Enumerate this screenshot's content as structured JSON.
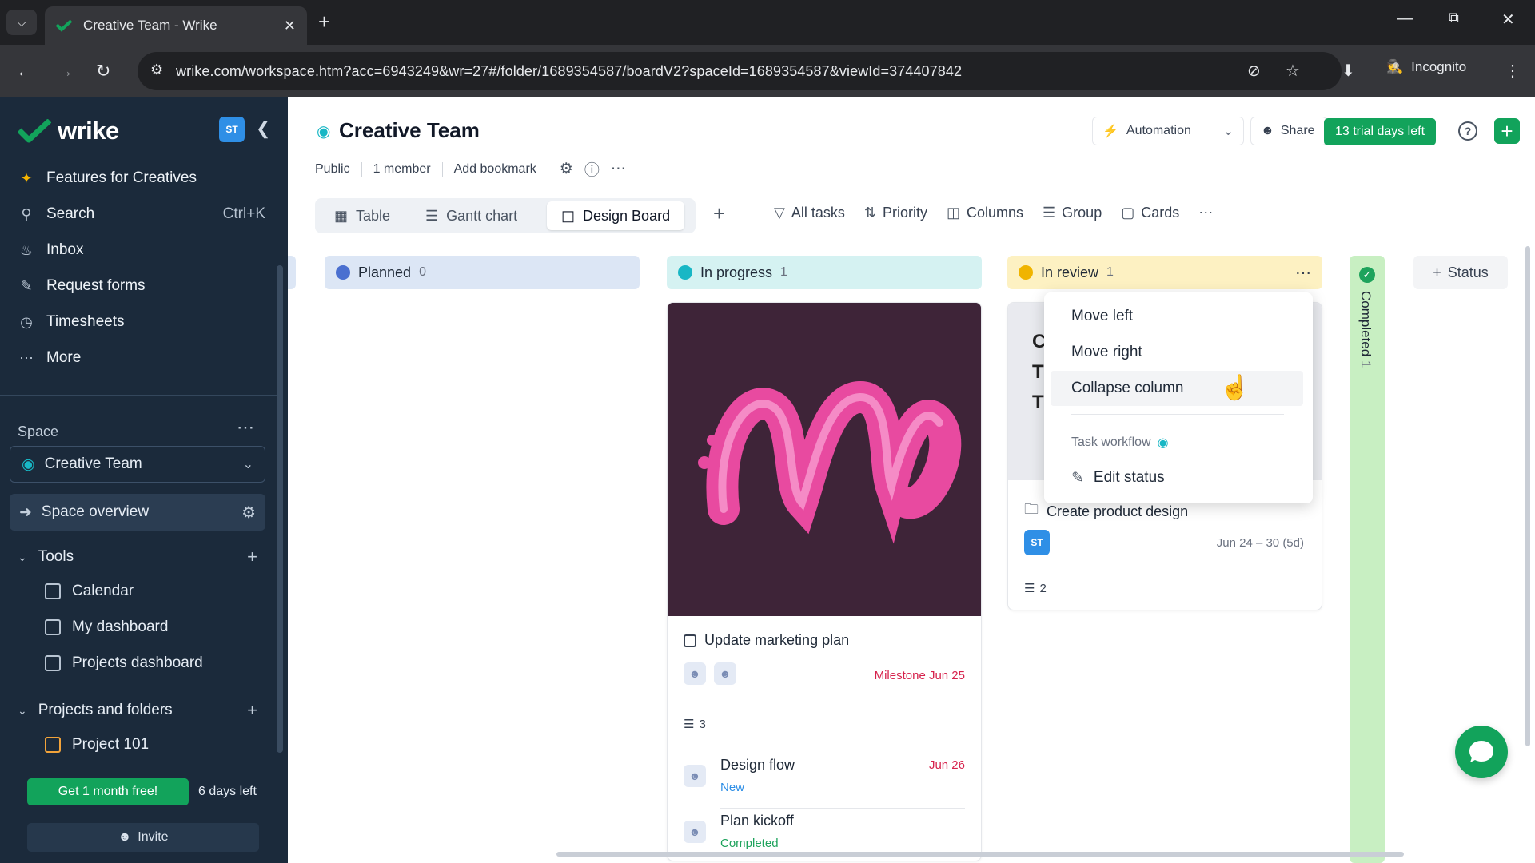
{
  "browser": {
    "tab_title": "Creative Team - Wrike",
    "url": "wrike.com/workspace.htm?acc=6943249&wr=27#/folder/1689354587/boardV2?spaceId=1689354587&viewId=374407842",
    "incognito_label": "Incognito"
  },
  "sidebar": {
    "logo_text": "wrike",
    "user_initials": "ST",
    "nav": [
      {
        "label": "Features for Creatives",
        "icon": "sparkle-icon"
      },
      {
        "label": "Search",
        "icon": "search-icon",
        "shortcut": "Ctrl+K"
      },
      {
        "label": "Inbox",
        "icon": "bell-icon"
      },
      {
        "label": "Request forms",
        "icon": "form-icon"
      },
      {
        "label": "Timesheets",
        "icon": "clock-icon"
      },
      {
        "label": "More",
        "icon": "dots-icon"
      }
    ],
    "space_label": "Space",
    "space_name": "Creative Team",
    "space_overview": "Space overview",
    "tools_label": "Tools",
    "tools": [
      "Calendar",
      "My dashboard",
      "Projects dashboard"
    ],
    "projects_label": "Projects and folders",
    "projects": [
      "Project 101"
    ],
    "promo_button": "Get 1 month free!",
    "days_left": "6 days left",
    "invite": "Invite"
  },
  "header": {
    "title": "Creative Team",
    "visibility": "Public",
    "members": "1 member",
    "bookmark": "Add bookmark",
    "automation": "Automation",
    "share": "Share",
    "trial": "13 trial days left"
  },
  "views": {
    "tabs": [
      "Table",
      "Gantt chart",
      "Design Board"
    ],
    "active": "Design Board",
    "filters": [
      "All tasks",
      "Priority",
      "Columns",
      "Group",
      "Cards"
    ]
  },
  "board": {
    "columns": [
      {
        "name": "Planned",
        "count": "0",
        "color": "#4a6fd0"
      },
      {
        "name": "In progress",
        "count": "1",
        "color": "#18b7c5"
      },
      {
        "name": "In review",
        "count": "1",
        "color": "#f0b400"
      },
      {
        "name": "Completed",
        "count": "1",
        "color": "#1ea35c"
      }
    ],
    "progress_card": {
      "task": "Update marketing plan",
      "milestone": "Milestone Jun 25",
      "subtask_count": "3",
      "subtasks": [
        {
          "name": "Design flow",
          "date": "Jun 26",
          "status": "New",
          "status_color": "#2f8fe6"
        },
        {
          "name": "Plan kickoff",
          "date": "",
          "status": "Completed",
          "status_color": "#1ea35c"
        }
      ]
    },
    "review_card": {
      "task": "Create product design",
      "assignee": "ST",
      "dates": "Jun 24 – 30 (5d)",
      "subtask_count": "2",
      "thumb_letters": "C\nT\nT"
    },
    "add_status": "Status"
  },
  "context_menu": {
    "items": [
      "Move left",
      "Move right",
      "Collapse column"
    ],
    "group_label": "Task workflow",
    "edit": "Edit status"
  }
}
